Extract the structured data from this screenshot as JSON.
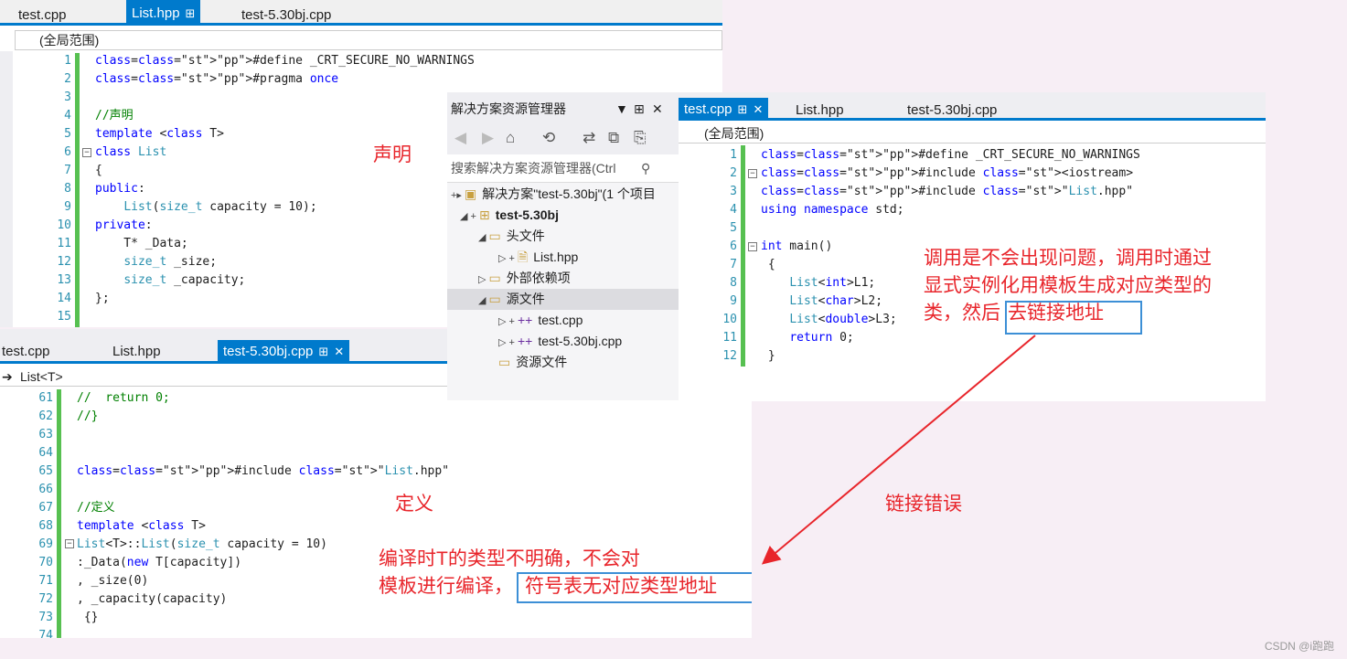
{
  "win_a": {
    "tabs": [
      "test.cpp",
      "List.hpp",
      "test-5.30bj.cpp"
    ],
    "scope": "(全局范围)",
    "lines": [
      {
        "n": "1",
        "t": "#define _CRT_SECURE_NO_WARNINGS"
      },
      {
        "n": "2",
        "t": "#pragma once"
      },
      {
        "n": "3",
        "t": ""
      },
      {
        "n": "4",
        "t": "//声明"
      },
      {
        "n": "5",
        "t": "template <class T>"
      },
      {
        "n": "6",
        "t": "class List"
      },
      {
        "n": "7",
        "t": "{"
      },
      {
        "n": "8",
        "t": "public:"
      },
      {
        "n": "9",
        "t": "    List(size_t capacity = 10);"
      },
      {
        "n": "10",
        "t": "private:"
      },
      {
        "n": "11",
        "t": "    T* _Data;"
      },
      {
        "n": "12",
        "t": "    size_t _size;"
      },
      {
        "n": "13",
        "t": "    size_t _capacity;"
      },
      {
        "n": "14",
        "t": "};"
      },
      {
        "n": "15",
        "t": ""
      }
    ],
    "annotation": "声明"
  },
  "win_b": {
    "tabs": [
      "test.cpp",
      "List.hpp",
      "test-5.30bj.cpp"
    ],
    "scope": "List<T>",
    "lines": [
      {
        "n": "61",
        "t": "//  return 0;"
      },
      {
        "n": "62",
        "t": "//}"
      },
      {
        "n": "63",
        "t": ""
      },
      {
        "n": "64",
        "t": ""
      },
      {
        "n": "65",
        "t": "#include \"List.hpp\""
      },
      {
        "n": "66",
        "t": ""
      },
      {
        "n": "67",
        "t": "//定义"
      },
      {
        "n": "68",
        "t": "template <class T>"
      },
      {
        "n": "69",
        "t": "List<T>::List(size_t capacity = 10)"
      },
      {
        "n": "70",
        "t": ":_Data(new T[capacity])"
      },
      {
        "n": "71",
        "t": ", _size(0)"
      },
      {
        "n": "72",
        "t": ", _capacity(capacity)"
      },
      {
        "n": "73",
        "t": " {}"
      },
      {
        "n": "74",
        "t": ""
      }
    ],
    "annotation": "定义",
    "note_line1": "编译时T的类型不明确，不会对",
    "note_line2a": "模板进行编译，",
    "note_line2b": "符号表无对应类型地址"
  },
  "solution_explorer": {
    "title": "解决方案资源管理器",
    "search_placeholder": "搜索解决方案资源管理器(Ctrl",
    "items": [
      {
        "label": "解决方案\"test-5.30bj\"(1 个项目"
      },
      {
        "label": "test-5.30bj"
      },
      {
        "label": "头文件"
      },
      {
        "label": "List.hpp"
      },
      {
        "label": "外部依赖项"
      },
      {
        "label": "源文件"
      },
      {
        "label": "test.cpp"
      },
      {
        "label": "test-5.30bj.cpp"
      },
      {
        "label": "资源文件"
      }
    ]
  },
  "win_c": {
    "tabs": [
      "test.cpp",
      "List.hpp",
      "test-5.30bj.cpp"
    ],
    "scope": "(全局范围)",
    "lines": [
      {
        "n": "1",
        "t": "#define _CRT_SECURE_NO_WARNINGS"
      },
      {
        "n": "2",
        "t": "#include <iostream>"
      },
      {
        "n": "3",
        "t": "#include \"List.hpp\""
      },
      {
        "n": "4",
        "t": "using namespace std;"
      },
      {
        "n": "5",
        "t": ""
      },
      {
        "n": "6",
        "t": "int main()"
      },
      {
        "n": "7",
        "t": " {"
      },
      {
        "n": "8",
        "t": "    List<int>L1;"
      },
      {
        "n": "9",
        "t": "    List<char>L2;"
      },
      {
        "n": "10",
        "t": "    List<double>L3;"
      },
      {
        "n": "11",
        "t": "    return 0;"
      },
      {
        "n": "12",
        "t": " }"
      }
    ],
    "note_line1": "调用是不会出现问题，调用时通过",
    "note_line2": "显式实例化用模板生成对应类型的",
    "note_line3a": "类，然后",
    "note_line3b": "去链接地址"
  },
  "link_error": "链接错误",
  "watermark": "CSDN @i跑跑",
  "colors": {
    "accent": "#007acc",
    "annotation": "#e8252b",
    "box": "#3c8fd6",
    "green": "#57c051"
  }
}
